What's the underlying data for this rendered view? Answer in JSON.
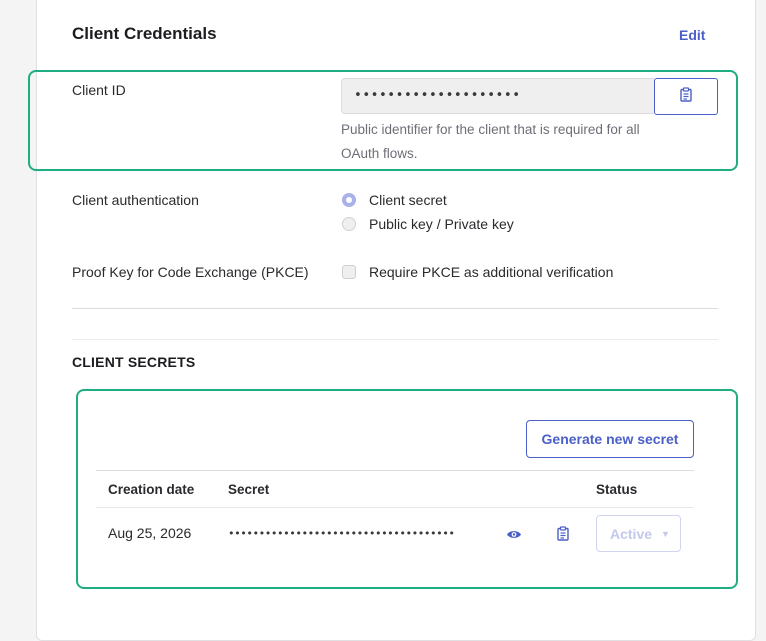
{
  "section": {
    "title": "Client Credentials",
    "edit_label": "Edit"
  },
  "client_id": {
    "label": "Client ID",
    "value": "••••••••••••••••••••",
    "help_line1": "Public identifier for the client that is required for all",
    "help_line2": "OAuth flows.",
    "copy_icon": "clipboard-icon"
  },
  "client_auth": {
    "label": "Client authentication",
    "options": [
      {
        "label": "Client secret",
        "selected": true
      },
      {
        "label": "Public key / Private key",
        "selected": false
      }
    ]
  },
  "pkce": {
    "label": "Proof Key for Code Exchange (PKCE)",
    "checkbox_label": "Require PKCE as additional verification",
    "checked": false
  },
  "secrets": {
    "title": "CLIENT SECRETS",
    "generate_label": "Generate new secret",
    "columns": [
      "Creation date",
      "Secret",
      "Status"
    ],
    "rows": [
      {
        "creation_date": "Aug 25, 2026",
        "secret": "•••••••••••••••••••••••••••••••••••••",
        "status": "Active",
        "reveal_icon": "eye-icon",
        "copy_icon": "clipboard-icon"
      }
    ]
  },
  "colors": {
    "accent": "#4b5fc8",
    "highlight": "#1fae82"
  }
}
